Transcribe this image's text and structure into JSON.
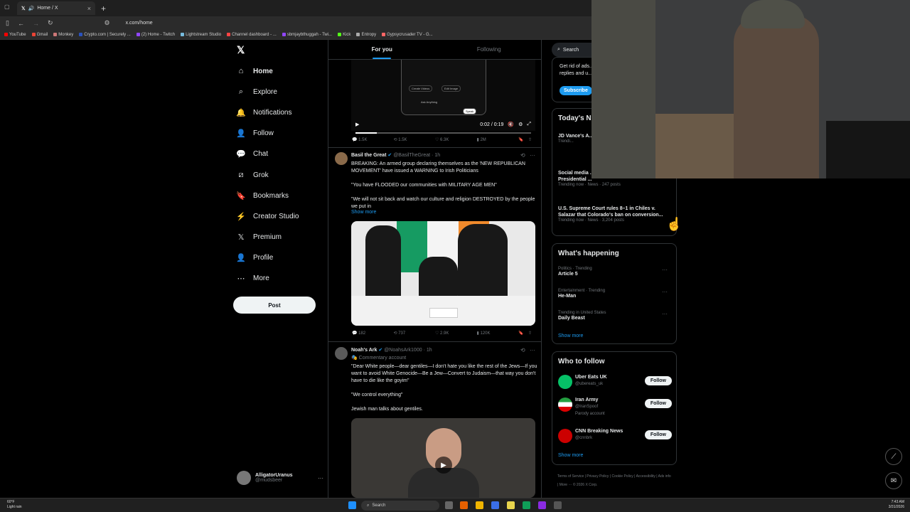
{
  "browser": {
    "tab_title": "Home / X",
    "url": "x.com/home",
    "bookmarks": [
      "YouTube",
      "Gmail",
      "Monkey",
      "Crypto.com | Securely ...",
      "(2) Home - Twitch",
      "Lightstream Studio",
      "Channel dashboard - ...",
      "sbmjaybthuggah - Twi...",
      "Kick",
      "Entropy",
      "Gypsycrusader TV - G..."
    ]
  },
  "nav": {
    "items": [
      "Home",
      "Explore",
      "Notifications",
      "Follow",
      "Chat",
      "Grok",
      "Bookmarks",
      "Creator Studio",
      "Premium",
      "Profile",
      "More"
    ],
    "post_label": "Post",
    "user_name": "AlligatorUranus",
    "user_handle": "@mudsbeer"
  },
  "feed": {
    "tabs": [
      "For you",
      "Following"
    ],
    "video1": {
      "time": "0:02 / 0:19",
      "ui_labels": [
        "Create Videos",
        "Edit Image",
        "Ask Anything",
        "Speak"
      ],
      "progress": 0.12
    },
    "actions1": [
      "1.5K",
      "1.5K",
      "6.3K",
      "2M"
    ],
    "post1": {
      "name": "Basil the Great",
      "handle": "@BasilTheGreat",
      "time": "1h",
      "line1": "BREAKING: An armed group declaring themselves as the 'NEW REPUBLICAN MOVEMENT' have issued a WARNING to Irish Politicians",
      "line2": "\"You have FLOODED our communities with MILITARY AGE MEN\"",
      "line3": "\"We will not sit back and watch our culture and religion DESTROYED by the people we put in",
      "show_more": "Show more",
      "actions": [
        "182",
        "737",
        "2.9K",
        "120K"
      ]
    },
    "post2": {
      "name": "Noah's Ark",
      "handle": "@NoahsArk1000",
      "time": "1h",
      "sub": "Commentary account",
      "line1": "\"Dear White people—dear gentiles—I don't hate you like the rest of the Jews—If you want to avoid White Genocide—Be a Jew—Convert to Judaism—that way you don't have to die like the goyim\"",
      "line2": "\"We control everything\"",
      "line3": "Jewish man talks about gentiles."
    }
  },
  "right": {
    "search_placeholder": "Search",
    "premium_text": "Get rid of ads... replies and u...",
    "subscribe": "Subscribe",
    "news_title": "Today's N...",
    "news": [
      {
        "title": "JD Vance's A... First Meeting",
        "meta": "Trendi..."
      },
      {
        "title": "Social media ... Donald Trump's proposed Presidential ...",
        "meta": "Trending now · News · 247 posts"
      },
      {
        "title": "U.S. Supreme Court rules 8–1 in Chiles v. Salazar that Colorado's ban on conversion...",
        "meta": "Trending now · News · 3,204 posts"
      }
    ],
    "happening_title": "What's happening",
    "trends": [
      {
        "meta": "Politics · Trending",
        "name": "Article 5"
      },
      {
        "meta": "Entertainment · Trending",
        "name": "He-Man"
      },
      {
        "meta": "Trending in United States",
        "name": "Daily Beast"
      }
    ],
    "show_more": "Show more",
    "wtf_title": "Who to follow",
    "follow": [
      {
        "name": "Uber Eats UK",
        "handle": "@ubereats_uk",
        "extra": ""
      },
      {
        "name": "Iran Army",
        "handle": "@IranSpoof",
        "extra": "Parody account"
      },
      {
        "name": "CNN Breaking News",
        "handle": "@cnnbrk",
        "extra": ""
      }
    ],
    "follow_label": "Follow",
    "footer": "Terms of Service | Privacy Policy | Cookie Policy | Accessibility | Ads info | More ··· © 2026 X Corp."
  },
  "taskbar": {
    "weather_temp": "60°F",
    "weather_desc": "Light rain",
    "search": "Search",
    "time": "7:43 AM",
    "date": "3/31/2026"
  },
  "colors": {
    "accent": "#1d9bf0",
    "bg": "#000000",
    "border": "#2f3336"
  }
}
